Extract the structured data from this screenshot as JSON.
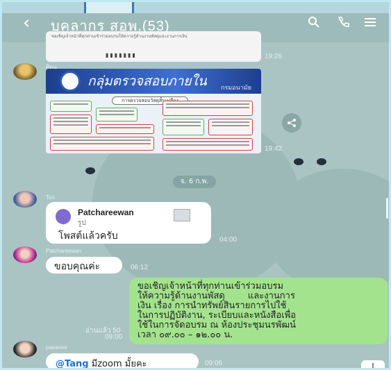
{
  "header": {
    "title": "บุคลากร สอพ.(53)",
    "back_icon": "chevron-left-icon",
    "icons": [
      "search-icon",
      "phone-icon",
      "menu-icon"
    ]
  },
  "messages": {
    "snippet": {
      "text": "ขอเชิญเจ้าหน้าที่ทุกท่านเข้าร่วมอบรมให้ความรู้ด้านงานพัสดุและงานการเงิน",
      "time": "19:26"
    },
    "poster_msg": {
      "sender": "ศิตน",
      "poster_title": "กลุ่มตรวจสอบภายใน",
      "poster_subtitle": "กรมอนามัย",
      "poster_caption": "การตรวจสอบวัสดุสิ้นเปลือง",
      "time": "19:42"
    },
    "date_divider": "จ. 6 ก.พ.",
    "reply_msg": {
      "sender": "Too",
      "reply_name": "Patchareewan",
      "reply_type": "รูป",
      "text": "โพสต์แล้วครับ",
      "time": "04:00"
    },
    "thanks_msg": {
      "sender": "Patchareewan",
      "text": "ขอบคุณค่ะ",
      "time": "06:12"
    },
    "announcement": {
      "read": "อ่านแล้ว 50",
      "time": "09:00",
      "lines": [
        "ขอเชิญเจ้าหน้าที่ทุกท่านเข้าร่วมอบรม",
        "ให้ความรู้ด้านงานพัสดุ        และงานการ",
        "เงิน เรื่อง การนำทรัพย์สินรายการไปใช้",
        "ในการปฏิบัติงาน, ระเบียบและหนังสือเพื่อ",
        "ใช้ในการจัดอบรม ณ ห้องประชุมนรพัฒน์",
        "เวลา ๐๙.๐๐ – ๑๒.๐๐ น."
      ]
    },
    "zoom_msg": {
      "sender": "papavee",
      "mention": "@Tang",
      "text": " มีzoom มั้ยคะ",
      "time": "09:06"
    }
  },
  "colors": {
    "background": "#a9c4c3",
    "bubble_green": "#a3e38d",
    "mention": "#1f6fd1"
  }
}
